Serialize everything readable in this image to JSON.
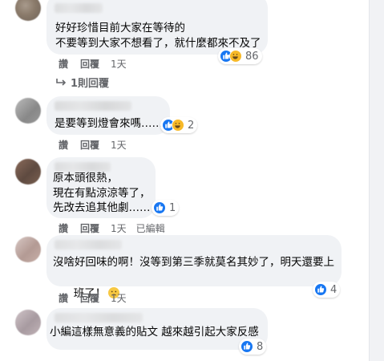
{
  "comments": [
    {
      "lines": [
        "好好珍惜目前大家在等待的",
        "不要等到大家不想看了，就什麼都來不及了"
      ],
      "reaction_count": "86",
      "reaction_icons": [
        "like-icon",
        "haha-icon"
      ],
      "like_label": "讚",
      "reply_label": "回覆",
      "time": "1天"
    },
    {
      "lines": [
        "是要等到燈會來嗎……"
      ],
      "reaction_count": "2",
      "reaction_icons": [
        "like-icon",
        "haha-icon"
      ],
      "like_label": "讚",
      "reply_label": "回覆",
      "time": "1天"
    },
    {
      "lines": [
        "原本頭很熱，",
        "現在有點涼涼等了，",
        "先改去追其他劇……"
      ],
      "reaction_count": "1",
      "reaction_icons": [
        "like-icon"
      ],
      "like_label": "讚",
      "reply_label": "回覆",
      "time": "1天",
      "edited": "已編輯"
    },
    {
      "lines": [
        "沒啥好回味的啊！沒等到第三季就莫名其妙了，明天還要上",
        "班了！"
      ],
      "reaction_count": "4",
      "reaction_icons": [
        "like-icon"
      ],
      "trailing_emoji": "worried-face-emoji",
      "like_label": "讚",
      "reply_label": "回覆",
      "time": "1天"
    },
    {
      "lines": [
        "小編這樣無意義的貼文 越來越引起大家反感"
      ],
      "reaction_count": "8",
      "reaction_icons": [
        "like-icon"
      ]
    }
  ],
  "replies_link": "1則回覆",
  "colors": {
    "bubble": "#f0f2f5",
    "like_blue": "#1877f2",
    "haha_yellow": "#f7b928",
    "meta_gray": "#65676b"
  }
}
